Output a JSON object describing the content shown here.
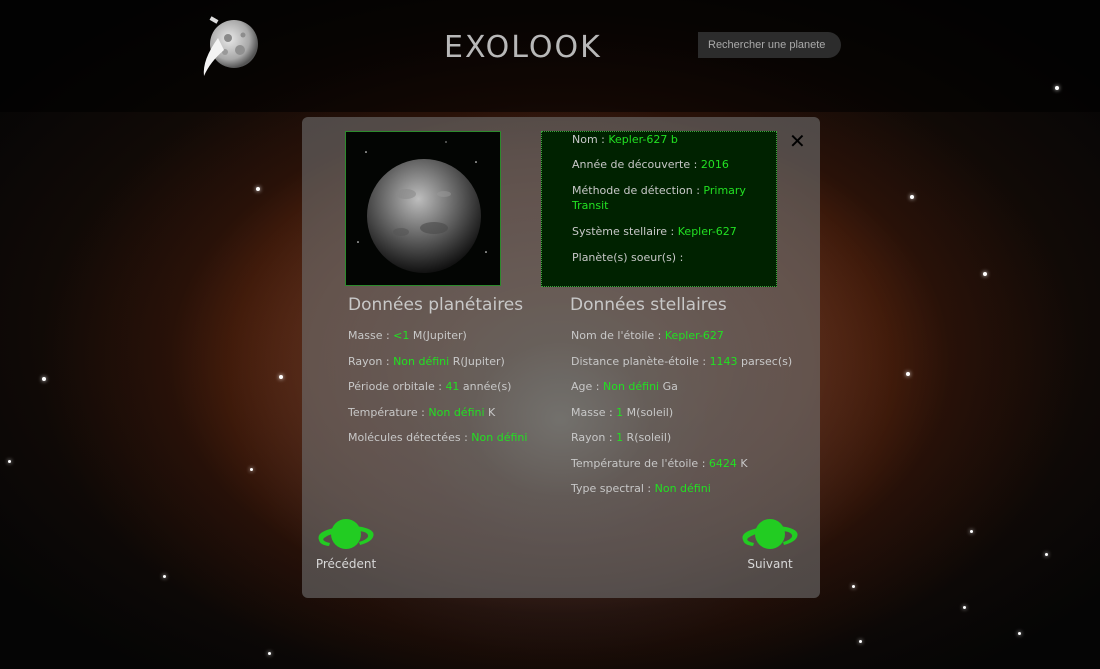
{
  "header": {
    "brand": "EXOLOOK",
    "search_placeholder": "Rechercher une planete",
    "logo_icon": "moon-satellite-icon"
  },
  "modal": {
    "close_icon": "close-icon",
    "info": {
      "nom_label": "Nom : ",
      "nom_value": "Kepler-627 b",
      "annee_label": "Année de découverte : ",
      "annee_value": "2016",
      "methode_label": "Méthode de détection : ",
      "methode_value": "Primary Transit",
      "systeme_label": "Système stellaire : ",
      "systeme_value": "Kepler-627",
      "soeurs_label": "Planète(s) soeur(s) :"
    },
    "planetary": {
      "title": "Données planétaires",
      "rows": [
        {
          "label": "Masse : ",
          "value": "<1",
          "unit": " M(Jupiter)"
        },
        {
          "label": "Rayon : ",
          "value": "Non défini",
          "unit": " R(Jupiter)"
        },
        {
          "label": "Période orbitale : ",
          "value": "41",
          "unit": " année(s)"
        },
        {
          "label": "Température : ",
          "value": "Non défini",
          "unit": " K"
        },
        {
          "label": "Molécules détectées : ",
          "value": "Non défini",
          "unit": ""
        }
      ]
    },
    "stellar": {
      "title": "Données stellaires",
      "rows": [
        {
          "label": "Nom de l'étoile : ",
          "value": "Kepler-627",
          "unit": ""
        },
        {
          "label": "Distance planète-étoile : ",
          "value": "1143",
          "unit": " parsec(s)"
        },
        {
          "label": "Age : ",
          "value": "Non défini",
          "unit": " Ga"
        },
        {
          "label": "Masse : ",
          "value": "1",
          "unit": " M(soleil)"
        },
        {
          "label": "Rayon : ",
          "value": "1",
          "unit": " R(soleil)"
        },
        {
          "label": "Température de l'étoile : ",
          "value": "6424",
          "unit": " K"
        },
        {
          "label": "Type spectral : ",
          "value": "Non défini",
          "unit": ""
        }
      ]
    },
    "nav": {
      "prev_label": "Précédent",
      "next_label": "Suivant",
      "icon": "saturn-planet-icon"
    }
  },
  "colors": {
    "accent_green": "#22e022",
    "info_bg": "#002200",
    "modal_bg": "rgba(110,110,110,0.62)"
  }
}
